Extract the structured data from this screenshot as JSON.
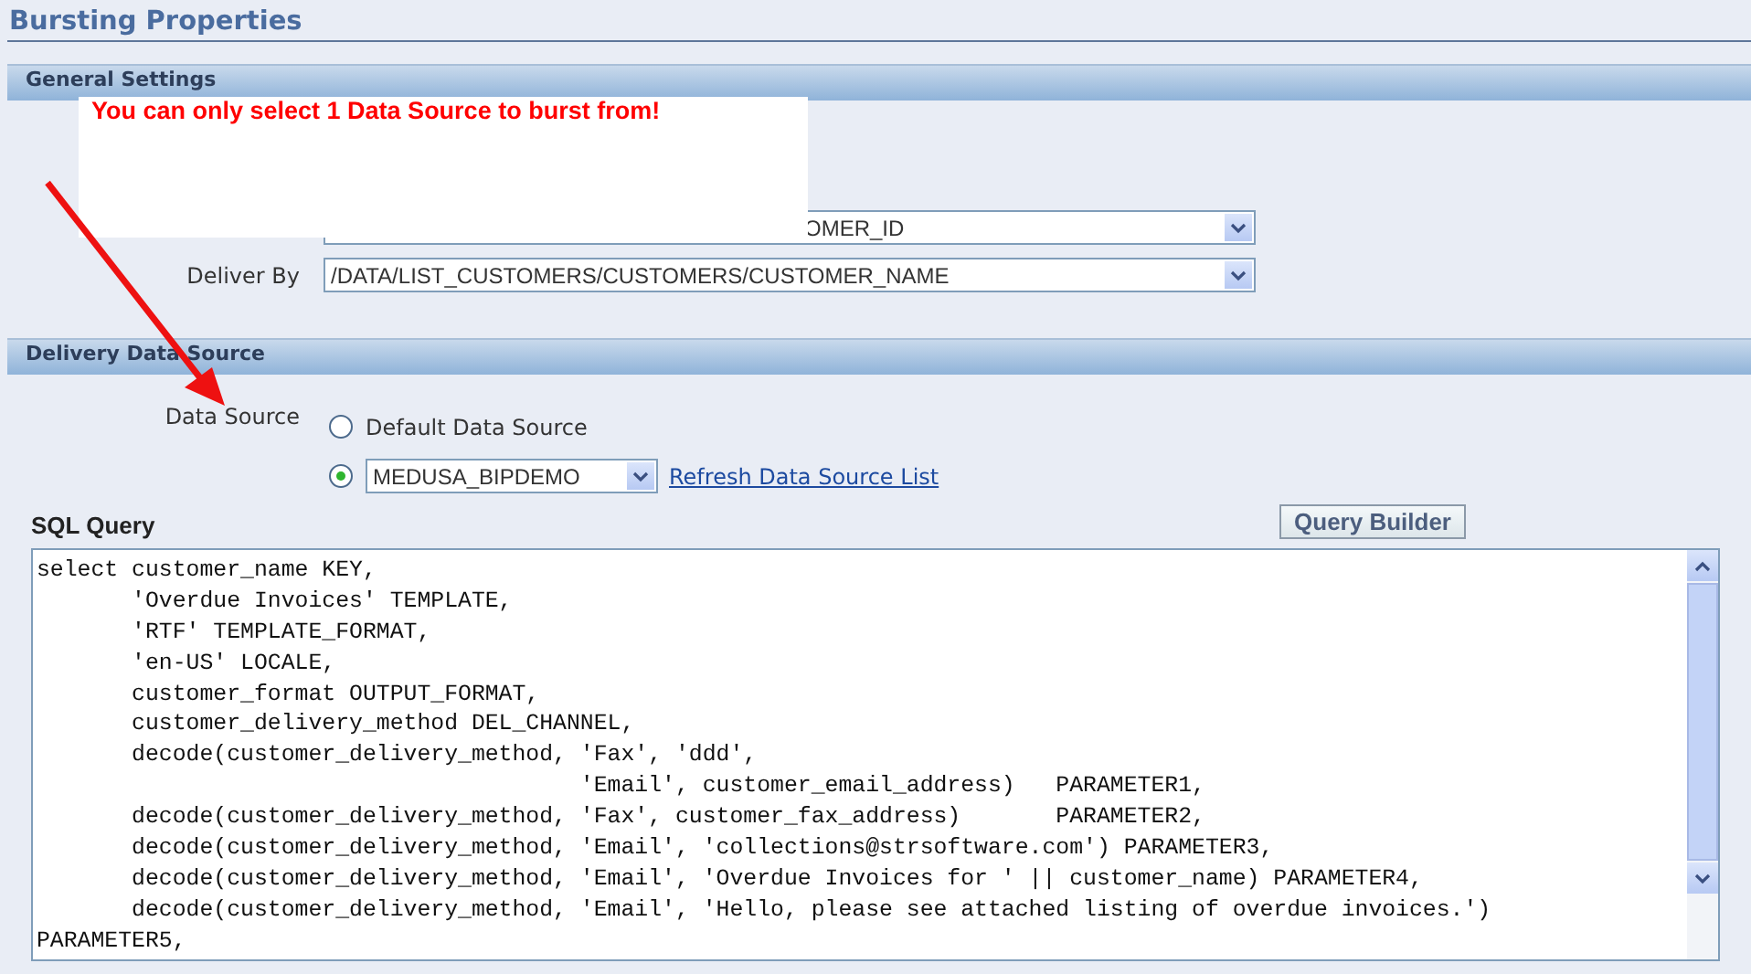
{
  "page": {
    "title": "Bursting Properties"
  },
  "general_settings": {
    "header": "General Settings",
    "fields": [
      {
        "value": "OMER_ID"
      },
      {
        "label": "Deliver By",
        "value": "/DATA/LIST_CUSTOMERS/CUSTOMERS/CUSTOMER_NAME"
      }
    ]
  },
  "delivery_data_source": {
    "header": "Delivery Data Source",
    "label": "Data Source",
    "options": [
      {
        "kind": "radio",
        "label": "Default Data Source",
        "selected": false
      },
      {
        "kind": "select",
        "value": "MEDUSA_BIPDEMO",
        "selected": true
      }
    ],
    "link": "Refresh Data Source List"
  },
  "sql_query": {
    "label": "SQL Query",
    "button": "Query Builder",
    "lines": [
      "select customer_name KEY,",
      "       'Overdue Invoices' TEMPLATE,",
      "       'RTF' TEMPLATE_FORMAT,",
      "       'en-US' LOCALE,",
      "       customer_format OUTPUT_FORMAT,",
      "       customer_delivery_method DEL_CHANNEL,",
      "       decode(customer_delivery_method, 'Fax', 'ddd',",
      "                                        'Email', customer_email_address)   PARAMETER1,",
      "       decode(customer_delivery_method, 'Fax', customer_fax_address)       PARAMETER2,",
      "       decode(customer_delivery_method, 'Email', 'collections@strsoftware.com') PARAMETER3,",
      "       decode(customer_delivery_method, 'Email', 'Overdue Invoices for ' || customer_name) PARAMETER4,",
      "       decode(customer_delivery_method, 'Email', 'Hello, please see attached listing of overdue invoices.')",
      "PARAMETER5,"
    ]
  },
  "callout": {
    "text": "You can only select 1 Data Source to burst from!"
  }
}
